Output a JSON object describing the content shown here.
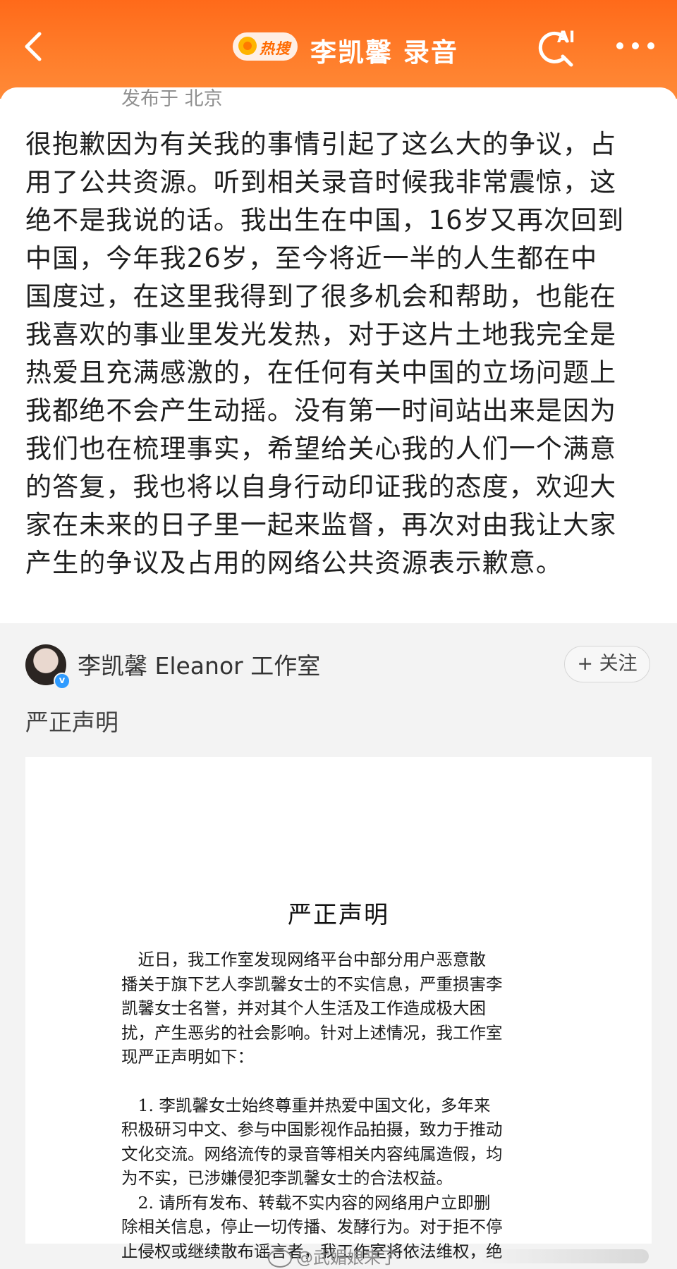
{
  "header": {
    "hot_badge": "热搜",
    "title": "李凯馨 录音",
    "ai_label": "AI"
  },
  "post": {
    "location": "发布于 北京",
    "lines": [
      "很抱歉因为有关我的事情引起了这么大的争议，占",
      "用了公共资源。听到相关录音时候我非常震惊，这",
      "绝不是我说的话。我出生在中国，16岁又再次回到",
      "中国，今年我26岁，至今将近一半的人生都在中",
      "国度过，在这里我得到了很多机会和帮助，也能在",
      "我喜欢的事业里发光发热，对于这片土地我完全是",
      "热爱且充满感激的，在任何有关中国的立场问题上",
      "我都绝不会产生动摇。没有第一时间站出来是因为",
      "我们也在梳理事实，希望给关心我的人们一个满意",
      "的答复，我也将以自身行动印证我的态度，欢迎大",
      "家在未来的日子里一起来监督，再次对由我让大家",
      "产生的争议及占用的网络公共资源表示歉意。"
    ]
  },
  "repost": {
    "author": "李凯馨 Eleanor 工作室",
    "follow_label": "+ 关注",
    "verified_mark": "v",
    "title": "严正声明",
    "document": {
      "heading": "严正声明",
      "lines": [
        "　近日，我工作室发现网络平台中部分用户恶意散",
        "播关于旗下艺人李凯馨女士的不实信息，严重损害李",
        "凯馨女士名誉，并对其个人生活及工作造成极大困",
        "扰，产生恶劣的社会影响。针对上述情况，我工作室",
        "现严正声明如下：",
        "",
        "　1. 李凯馨女士始终尊重并热爱中国文化，多年来",
        "积极研习中文、参与中国影视作品拍摄，致力于推动",
        "文化交流。网络流传的录音等相关内容纯属造假，均",
        "为不实，已涉嫌侵犯李凯馨女士的合法权益。",
        "　2. 请所有发布、转载不实内容的网络用户立即删",
        "除相关信息，停止一切传播、发酵行为。对于拒不停",
        "止侵权或继续散布谣言者，我工作室将依法维权，绝"
      ]
    }
  },
  "watermark": "@武媚娘来了",
  "colors": {
    "header_orange": "#ff6a1a",
    "verified_blue": "#2f9bff",
    "hot_orange": "#ff6a00"
  }
}
